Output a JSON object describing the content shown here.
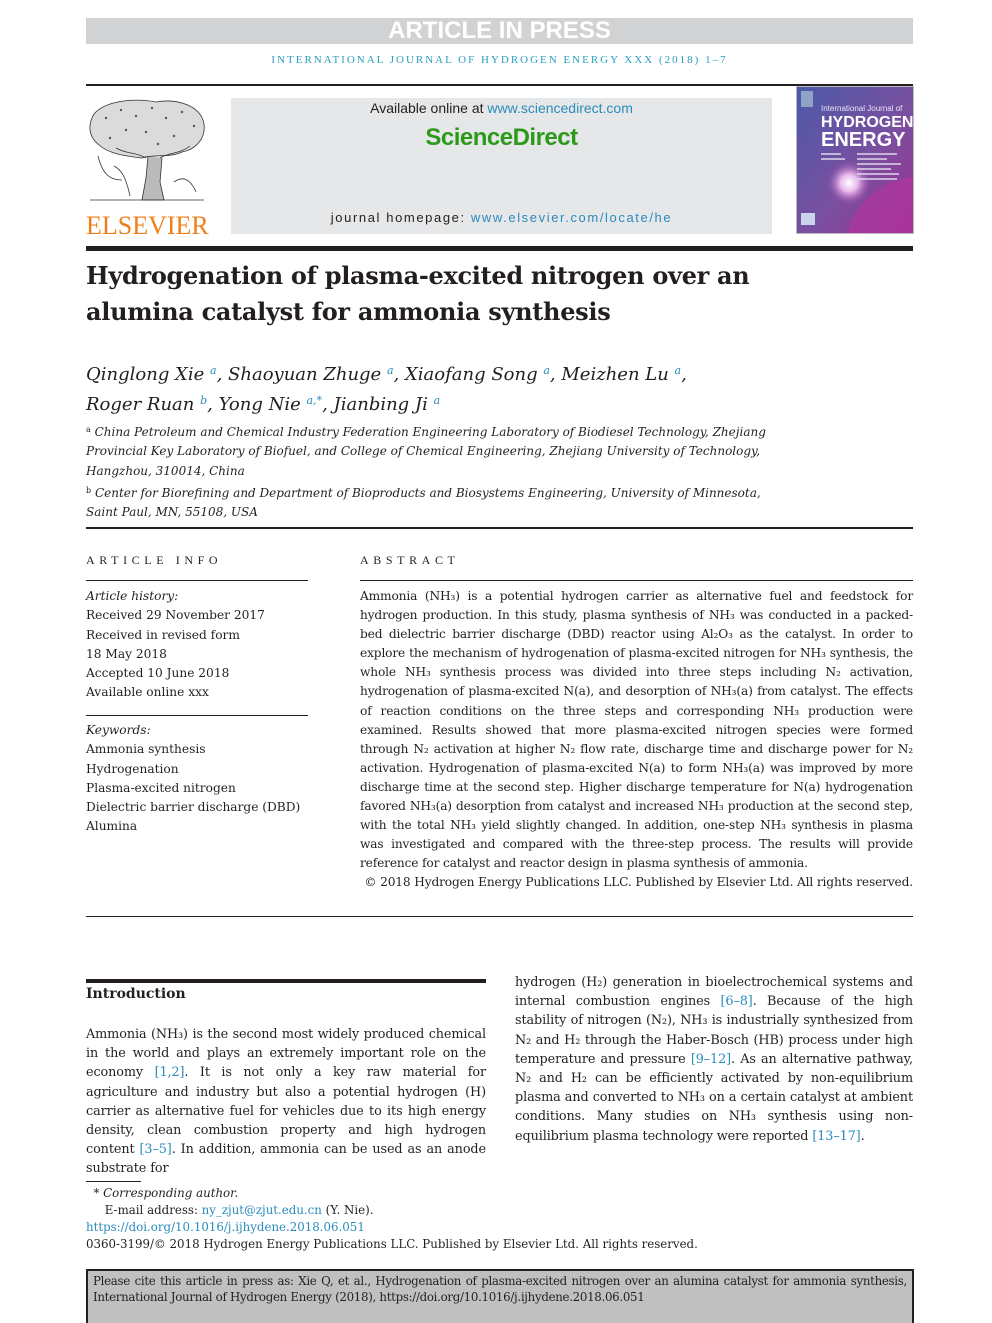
{
  "banner": "ARTICLE IN PRESS",
  "journal_running_head": "INTERNATIONAL JOURNAL OF HYDROGEN ENERGY XXX (2018) 1–7",
  "publisher": {
    "logo_word": "ELSEVIER",
    "logo_color": "#f07f1a"
  },
  "sciencedirect": {
    "available_prefix": "Available online at ",
    "available_link": "www.sciencedirect.com",
    "brand": "ScienceDirect",
    "brand_color": "#2b9a1b",
    "homepage_prefix": "journal homepage: ",
    "homepage_link": "www.elsevier.com/locate/he"
  },
  "cover": {
    "line1": "International Journal of",
    "line2": "HYDROGEN",
    "line3": "ENERGY"
  },
  "article": {
    "title_line1": "Hydrogenation of plasma-excited nitrogen over an",
    "title_line2": "alumina catalyst for ammonia synthesis",
    "authors": [
      {
        "name": "Qinglong Xie",
        "aff": "a",
        "sep": ", "
      },
      {
        "name": "Shaoyuan Zhuge",
        "aff": "a",
        "sep": ", "
      },
      {
        "name": "Xiaofang Song",
        "aff": "a",
        "sep": ", "
      },
      {
        "name": "Meizhen Lu",
        "aff": "a",
        "sep": ","
      },
      {
        "name": "Roger Ruan",
        "aff": "b",
        "sep": ", "
      },
      {
        "name": "Yong Nie",
        "aff": "a,*",
        "sep": ", "
      },
      {
        "name": "Jianbing Ji",
        "aff": "a",
        "sep": ""
      }
    ],
    "affiliations": [
      {
        "mark": "a",
        "text": "China Petroleum and Chemical Industry Federation Engineering Laboratory of Biodiesel Technology, Zhejiang Provincial Key Laboratory of Biofuel, and College of Chemical Engineering, Zhejiang University of Technology, Hangzhou, 310014, China"
      },
      {
        "mark": "b",
        "text": "Center for Biorefining and Department of Bioproducts and Biosystems Engineering, University of Minnesota, Saint Paul, MN, 55108, USA"
      }
    ]
  },
  "article_info": {
    "label": "ARTICLE INFO",
    "history_label": "Article history:",
    "history": [
      "Received 29 November 2017",
      "Received in revised form",
      "18 May 2018",
      "Accepted 10 June 2018",
      "Available online xxx"
    ],
    "keywords_label": "Keywords:",
    "keywords": [
      "Ammonia synthesis",
      "Hydrogenation",
      "Plasma-excited nitrogen",
      "Dielectric barrier discharge (DBD)",
      "Alumina"
    ]
  },
  "abstract": {
    "label": "ABSTRACT",
    "text": "Ammonia (NH₃) is a potential hydrogen carrier as alternative fuel and feedstock for hydrogen production. In this study, plasma synthesis of NH₃ was conducted in a packed-bed dielectric barrier discharge (DBD) reactor using Al₂O₃ as the catalyst. In order to explore the mechanism of hydrogenation of plasma-excited nitrogen for NH₃ synthesis, the whole NH₃ synthesis process was divided into three steps including N₂ activation, hydrogenation of plasma-excited N(a), and desorption of NH₃(a) from catalyst. The effects of reaction conditions on the three steps and corresponding NH₃ production were examined. Results showed that more plasma-excited nitrogen species were formed through N₂ activation at higher N₂ flow rate, discharge time and discharge power for N₂ activation. Hydrogenation of plasma-excited N(a) to form NH₃(a) was improved by more discharge time at the second step. Higher discharge temperature for N(a) hydrogenation favored NH₃(a) desorption from catalyst and increased NH₃ production at the second step, with the total NH₃ yield slightly changed. In addition, one-step NH₃ synthesis in plasma was investigated and compared with the three-step process. The results will provide reference for catalyst and reactor design in plasma synthesis of ammonia.",
    "copyright": "© 2018 Hydrogen Energy Publications LLC. Published by Elsevier Ltd. All rights reserved."
  },
  "introduction": {
    "heading": "Introduction",
    "left_segments": [
      {
        "t": "Ammonia (NH₃) is the second most widely produced chemical in the world and plays an extremely important role on the economy "
      },
      {
        "ref": "[1,2]"
      },
      {
        "t": ". It is not only a key raw material for agriculture and industry but also a potential hydrogen (H) carrier as alternative fuel for vehicles due to its high energy density, clean combustion property and high hydrogen content "
      },
      {
        "ref": "[3–5]"
      },
      {
        "t": ". In addition, ammonia can be used as an anode substrate for"
      }
    ],
    "right_segments": [
      {
        "t": "hydrogen (H₂) generation in bioelectrochemical systems and internal combustion engines "
      },
      {
        "ref": "[6–8]"
      },
      {
        "t": ". Because of the high stability of nitrogen (N₂), NH₃ is industrially synthesized from N₂ and H₂ through the Haber-Bosch (HB) process under high temperature and pressure "
      },
      {
        "ref": "[9–12]"
      },
      {
        "t": ". As an alternative pathway, N₂ and H₂ can be efficiently activated by non-equilibrium plasma and converted to NH₃ on a certain catalyst at ambient conditions. Many studies on NH₃ synthesis using non-equilibrium plasma technology were reported "
      },
      {
        "ref": "[13–17]"
      },
      {
        "t": "."
      }
    ]
  },
  "footnotes": {
    "corresponding_mark": "*",
    "corresponding_label": "Corresponding author.",
    "email_label": "E-mail address: ",
    "email": "ny_zjut@zjut.edu.cn",
    "email_suffix": " (Y. Nie).",
    "doi": "https://doi.org/10.1016/j.ijhydene.2018.06.051",
    "issn_copyright": "0360-3199/© 2018 Hydrogen Energy Publications LLC. Published by Elsevier Ltd. All rights reserved."
  },
  "citation_box": "Please cite this article in press as: Xie Q, et al., Hydrogenation of plasma-excited nitrogen over an alumina catalyst for ammonia synthesis, International Journal of Hydrogen Energy (2018), https://doi.org/10.1016/j.ijhydene.2018.06.051",
  "colors": {
    "link": "#2a8bbd",
    "running_head": "#2a9fc0",
    "banner_bg": "#d1d2d4",
    "cite_bg": "#c0c0c0"
  }
}
